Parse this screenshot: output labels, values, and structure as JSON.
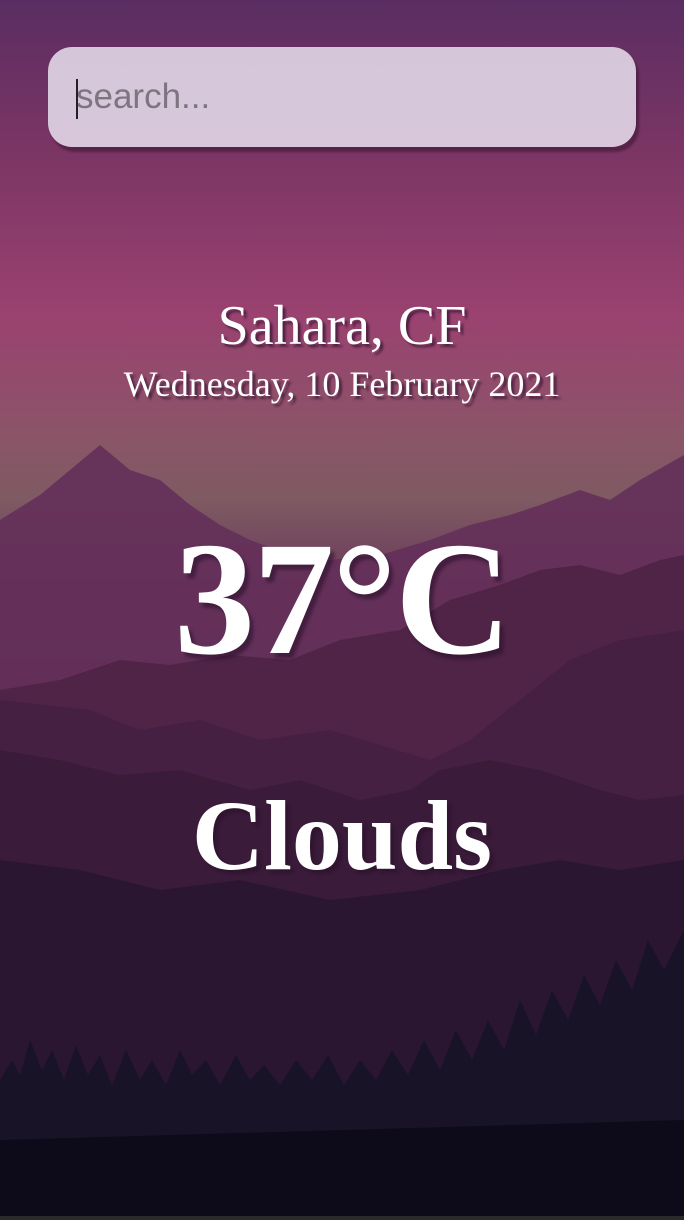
{
  "search": {
    "placeholder": "search...",
    "value": ""
  },
  "location": {
    "city_country": "Sahara, CF",
    "date": "Wednesday, 10 February 2021"
  },
  "weather": {
    "temperature": "37°C",
    "condition": "Clouds"
  },
  "colors": {
    "sky_top": "#5a2d62",
    "sky_glow": "#9a4270",
    "mountains_far": "#5e2a52",
    "mountains_near": "#3b1d3d",
    "forest": "#100e1e",
    "text": "#ffffff"
  }
}
